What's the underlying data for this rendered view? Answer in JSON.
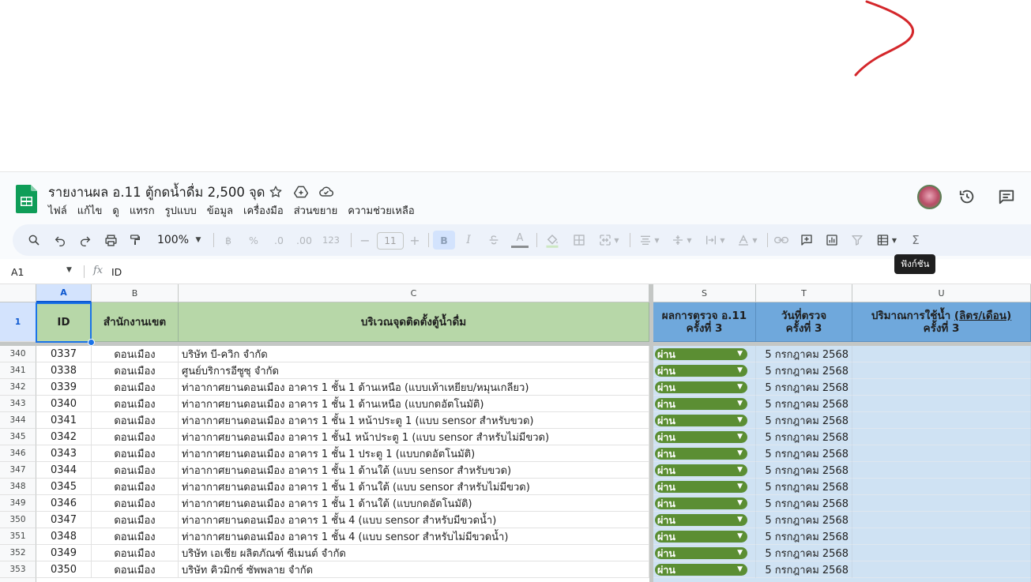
{
  "document": {
    "title": "รายงานผล อ.11 ตู้กดน้ำดื่ม 2,500 จุด"
  },
  "menu": [
    "ไฟล์",
    "แก้ไข",
    "ดู",
    "แทรก",
    "รูปแบบ",
    "ข้อมูล",
    "เครื่องมือ",
    "ส่วนขยาย",
    "ความช่วยเหลือ"
  ],
  "toolbar": {
    "zoom": "100%",
    "currency": "฿",
    "percent": "%",
    "decrease_decimal": ".0",
    "increase_decimal": ".00",
    "number_format": "123",
    "font_size": "11",
    "bold": "B",
    "italic": "I",
    "text_color": "A",
    "tooltip": "ฟังก์ชัน"
  },
  "formula_bar": {
    "cell_ref": "A1",
    "fx": "fx",
    "value": "ID"
  },
  "columns": {
    "letters": [
      "A",
      "B",
      "C",
      "S",
      "T",
      "U"
    ],
    "selected": "A"
  },
  "header_row": {
    "row_number": "1",
    "id": "ID",
    "office": "สำนักงานเขต",
    "location": "บริเวณจุดติดตั้งตู้น้ำดื่ม",
    "result_line1": "ผลการตรวจ อ.11",
    "result_line2": "ครั้งที่ 3",
    "date_line1": "วันที่ตรวจ",
    "date_line2": "ครั้งที่ 3",
    "usage_line1_prefix": "ปริมาณการใช้น้ำ ",
    "usage_line1_unit": "(ลิตร/เดือน)",
    "usage_line2": "ครั้งที่ 3"
  },
  "rows": [
    {
      "n": "340",
      "id": "0337",
      "office": "ดอนเมือง",
      "location": "บริษัท บี-ควิก จำกัด",
      "result": "ผ่าน",
      "date": "5 กรกฎาคม 2568",
      "usage": ""
    },
    {
      "n": "341",
      "id": "0338",
      "office": "ดอนเมือง",
      "location": "ศูนย์บริการอีซูซุ จำกัด",
      "result": "ผ่าน",
      "date": "5 กรกฎาคม 2568",
      "usage": ""
    },
    {
      "n": "342",
      "id": "0339",
      "office": "ดอนเมือง",
      "location": "ท่าอากาศยานดอนเมือง อาคาร 1 ชั้น 1 ด้านเหนือ (แบบเท้าเหยียบ/หมุนเกลียว)",
      "result": "ผ่าน",
      "date": "5 กรกฎาคม 2568",
      "usage": ""
    },
    {
      "n": "343",
      "id": "0340",
      "office": "ดอนเมือง",
      "location": "ท่าอากาศยานดอนเมือง อาคาร 1 ชั้น 1 ด้านเหนือ (แบบกดอัตโนมัติ)",
      "result": "ผ่าน",
      "date": "5 กรกฎาคม 2568",
      "usage": ""
    },
    {
      "n": "344",
      "id": "0341",
      "office": "ดอนเมือง",
      "location": "ท่าอากาศยานดอนเมือง อาคาร 1 ชั้น 1 หน้าประตู 1 (แบบ sensor สำหรับขวด)",
      "result": "ผ่าน",
      "date": "5 กรกฎาคม 2568",
      "usage": ""
    },
    {
      "n": "345",
      "id": "0342",
      "office": "ดอนเมือง",
      "location": "ท่าอากาศยานดอนเมือง อาคาร 1 ชั้น1 หน้าประตู 1 (แบบ sensor สำหรับไม่มีขวด)",
      "result": "ผ่าน",
      "date": "5 กรกฎาคม 2568",
      "usage": ""
    },
    {
      "n": "346",
      "id": "0343",
      "office": "ดอนเมือง",
      "location": "ท่าอากาศยานดอนเมือง อาคาร 1 ชั้น 1 ประตู 1 (แบบกดอัตโนมัติ)",
      "result": "ผ่าน",
      "date": "5 กรกฎาคม 2568",
      "usage": ""
    },
    {
      "n": "347",
      "id": "0344",
      "office": "ดอนเมือง",
      "location": "ท่าอากาศยานดอนเมือง อาคาร 1 ชั้น 1 ด้านใต้ (แบบ sensor สำหรับขวด)",
      "result": "ผ่าน",
      "date": "5 กรกฎาคม 2568",
      "usage": ""
    },
    {
      "n": "348",
      "id": "0345",
      "office": "ดอนเมือง",
      "location": "ท่าอากาศยานดอนเมือง อาคาร 1 ชั้น 1 ด้านใต้ (แบบ sensor สำหรับไม่มีขวด)",
      "result": "ผ่าน",
      "date": "5 กรกฎาคม 2568",
      "usage": ""
    },
    {
      "n": "349",
      "id": "0346",
      "office": "ดอนเมือง",
      "location": "ท่าอากาศยานดอนเมือง อาคาร 1 ชั้น 1 ด้านใต้ (แบบกดอัตโนมัติ)",
      "result": "ผ่าน",
      "date": "5 กรกฎาคม 2568",
      "usage": ""
    },
    {
      "n": "350",
      "id": "0347",
      "office": "ดอนเมือง",
      "location": "ท่าอากาศยานดอนเมือง อาคาร 1 ชั้น 4 (แบบ sensor สำหรับมีขวดน้ำ)",
      "result": "ผ่าน",
      "date": "5 กรกฎาคม 2568",
      "usage": ""
    },
    {
      "n": "351",
      "id": "0348",
      "office": "ดอนเมือง",
      "location": "ท่าอากาศยานดอนเมือง อาคาร 1 ชั้น 4 (แบบ sensor สำหรับไม่มีขวดน้ำ)",
      "result": "ผ่าน",
      "date": "5 กรกฎาคม 2568",
      "usage": ""
    },
    {
      "n": "352",
      "id": "0349",
      "office": "ดอนเมือง",
      "location": "บริษัท เอเชีย ผลิตภัณฑ์ ซีเมนต์ จำกัด",
      "result": "ผ่าน",
      "date": "5 กรกฎาคม 2568",
      "usage": ""
    },
    {
      "n": "353",
      "id": "0350",
      "office": "ดอนเมือง",
      "location": "บริษัท คิวมิกซ์ ซัพพลาย จำกัด",
      "result": "ผ่าน",
      "date": "5 กรกฎาคม 2568",
      "usage": ""
    }
  ],
  "colors": {
    "header_green": "#b7d7a8",
    "header_blue": "#6fa8dc",
    "cell_blue": "#cfe2f3",
    "chip_green": "#5b8e33",
    "selection": "#1a73e8"
  }
}
